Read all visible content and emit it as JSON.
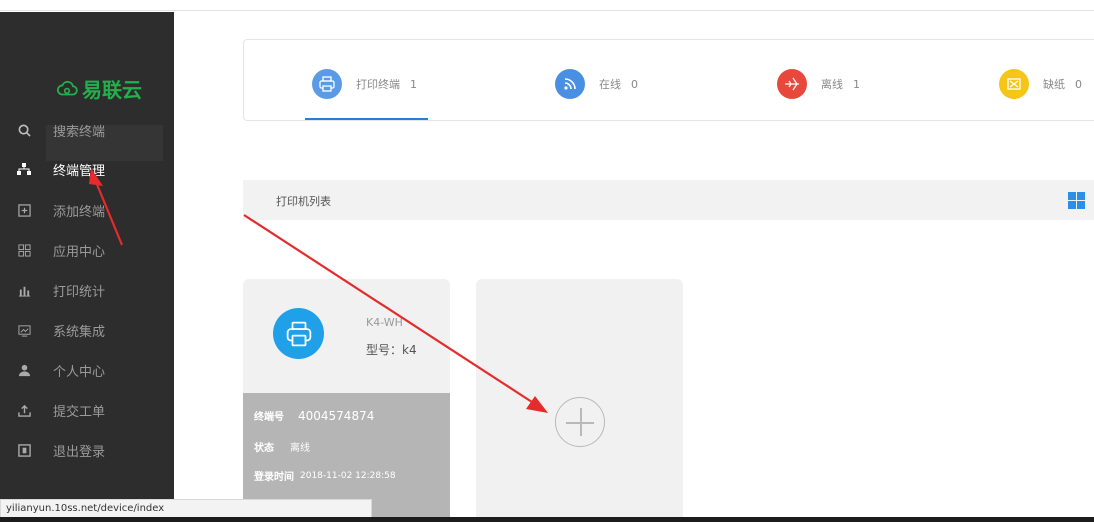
{
  "app": {
    "logo_text": "易联云",
    "accent": "#22b04d"
  },
  "sidebar": {
    "search_placeholder": "搜索终端",
    "items": [
      {
        "label": "终端管理",
        "icon": "sitemap-icon"
      },
      {
        "label": "添加终端",
        "icon": "add-box-icon"
      },
      {
        "label": "应用中心",
        "icon": "apps-grid-icon"
      },
      {
        "label": "打印统计",
        "icon": "bar-chart-icon"
      },
      {
        "label": "系统集成",
        "icon": "integration-icon"
      },
      {
        "label": "个人中心",
        "icon": "user-icon"
      },
      {
        "label": "提交工单",
        "icon": "upload-icon"
      },
      {
        "label": "退出登录",
        "icon": "logout-icon"
      }
    ]
  },
  "stats": [
    {
      "label": "打印终端",
      "value": "1",
      "color": "#5b9be6",
      "icon": "printer-icon"
    },
    {
      "label": "在线",
      "value": "0",
      "color": "#4a90e2",
      "icon": "wifi-icon"
    },
    {
      "label": "离线",
      "value": "1",
      "color": "#e8473b",
      "icon": "airplane-icon"
    },
    {
      "label": "缺纸",
      "value": "0",
      "color": "#f5c518",
      "icon": "paper-missing-icon"
    }
  ],
  "list": {
    "title": "打印机列表"
  },
  "device": {
    "name": "K4-WH",
    "model": "型号：k4",
    "terminal_label": "终端号",
    "terminal_value": "4004574874",
    "status_label": "状态",
    "status_value": "离线",
    "login_label": "登录时间",
    "login_value": "2018-11-02 12:28:58"
  },
  "statusbar": {
    "url": "yilianyun.10ss.net/device/index"
  }
}
